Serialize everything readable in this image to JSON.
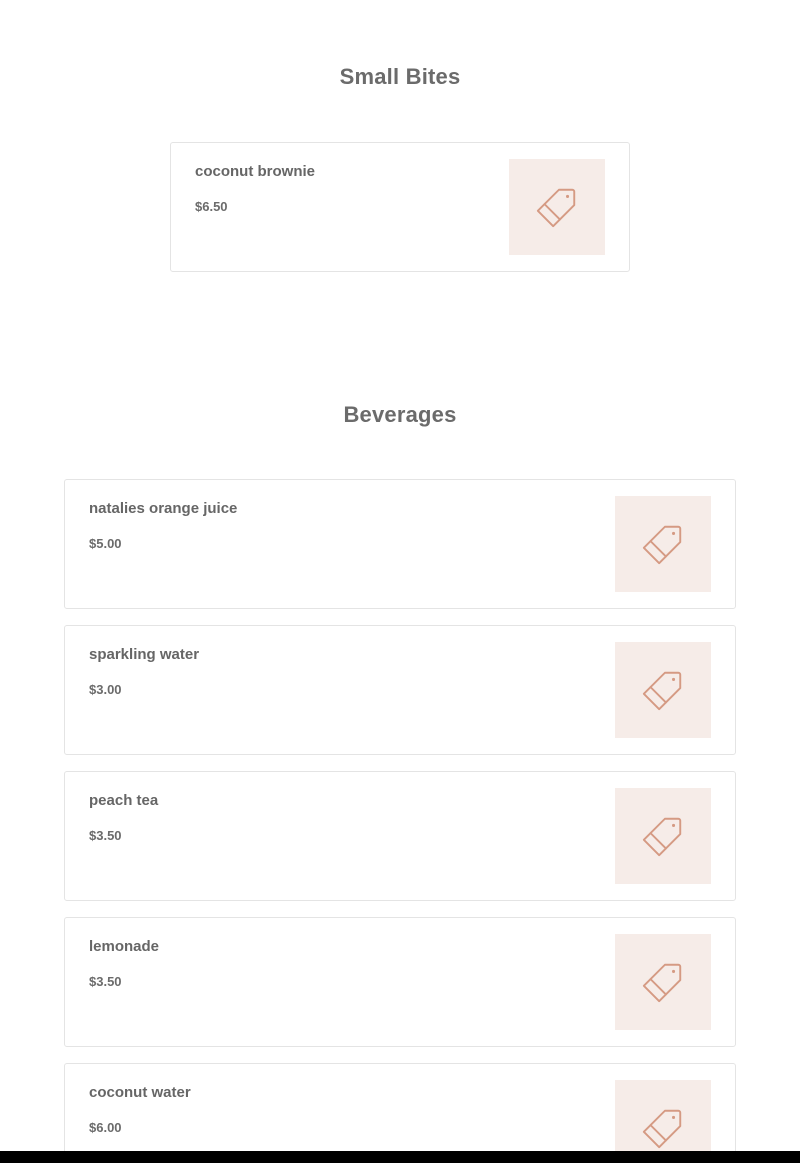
{
  "sections": [
    {
      "title": "Small Bites",
      "items": [
        {
          "name": "coconut brownie",
          "price": "$6.50",
          "icon": "price-tag-icon"
        }
      ]
    },
    {
      "title": "Beverages",
      "items": [
        {
          "name": "natalies orange juice",
          "price": "$5.00",
          "icon": "price-tag-icon"
        },
        {
          "name": "sparkling water",
          "price": "$3.00",
          "icon": "price-tag-icon"
        },
        {
          "name": "peach tea",
          "price": "$3.50",
          "icon": "price-tag-icon"
        },
        {
          "name": "lemonade",
          "price": "$3.50",
          "icon": "price-tag-icon"
        },
        {
          "name": "coconut water",
          "price": "$6.00",
          "icon": "price-tag-icon"
        }
      ]
    }
  ],
  "colors": {
    "thumbnail_bg": "#f6ece8",
    "icon_stroke": "#d59a83",
    "text": "#6b6b6b",
    "card_border": "#e4e4e4"
  }
}
